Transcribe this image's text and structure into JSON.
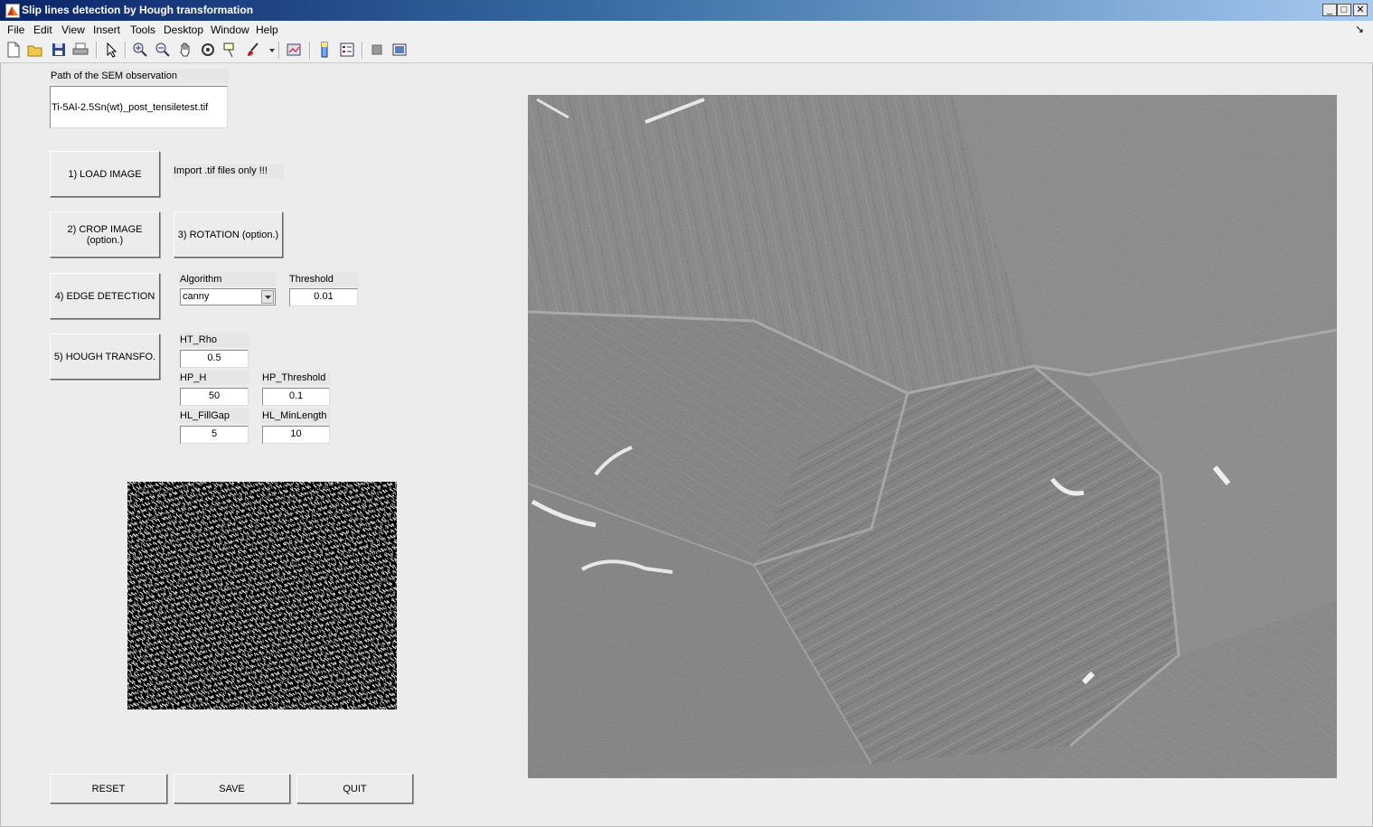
{
  "window": {
    "title": "Slip lines detection by Hough transformation",
    "controls": {
      "minimize": "_",
      "maximize": "□",
      "close": "✕"
    }
  },
  "menu": [
    "File",
    "Edit",
    "View",
    "Insert",
    "Tools",
    "Desktop",
    "Window",
    "Help"
  ],
  "menu_dock_glyph": "↘",
  "toolbar_icons": [
    "new-figure-icon",
    "open-file-icon",
    "save-icon",
    "print-icon",
    "edit-plot-arrow-icon",
    "zoom-in-icon",
    "zoom-out-icon",
    "pan-hand-icon",
    "rotate-3d-icon",
    "data-cursor-icon",
    "brush-icon",
    "brush-dropdown-icon",
    "link-plot-icon",
    "insert-colorbar-icon",
    "insert-legend-icon",
    "hide-plot-tools-icon",
    "show-plot-tools-icon"
  ],
  "path": {
    "label": "Path of the SEM observation",
    "value": "Ti-5Al-2.5Sn(wt)_post_tensiletest.tif"
  },
  "buttons": {
    "load": "1) LOAD IMAGE",
    "crop": "2) CROP IMAGE (option.)",
    "rotation": "3) ROTATION (option.)",
    "edge": "4) EDGE DETECTION",
    "hough": "5) HOUGH TRANSFO.",
    "reset": "RESET",
    "save": "SAVE",
    "quit": "QUIT"
  },
  "import_note": "Import .tif files only !!!",
  "edge_params": {
    "algorithm_label": "Algorithm",
    "algorithm_value": "canny",
    "threshold_label": "Threshold",
    "threshold_value": "0.01"
  },
  "hough_params": {
    "ht_rho_label": "HT_Rho",
    "ht_rho_value": "0.5",
    "hp_h_label": "HP_H",
    "hp_h_value": "50",
    "hp_threshold_label": "HP_Threshold",
    "hp_threshold_value": "0.1",
    "hl_fillgap_label": "HL_FillGap",
    "hl_fillgap_value": "5",
    "hl_minlength_label": "HL_MinLength",
    "hl_minlength_value": "10"
  },
  "colors": {
    "titlebar_start": "#0a246a",
    "titlebar_end": "#a6caf0",
    "panel_bg": "#ececec",
    "sem_gray": "#7c7c7c",
    "edge_bg": "#000000"
  }
}
